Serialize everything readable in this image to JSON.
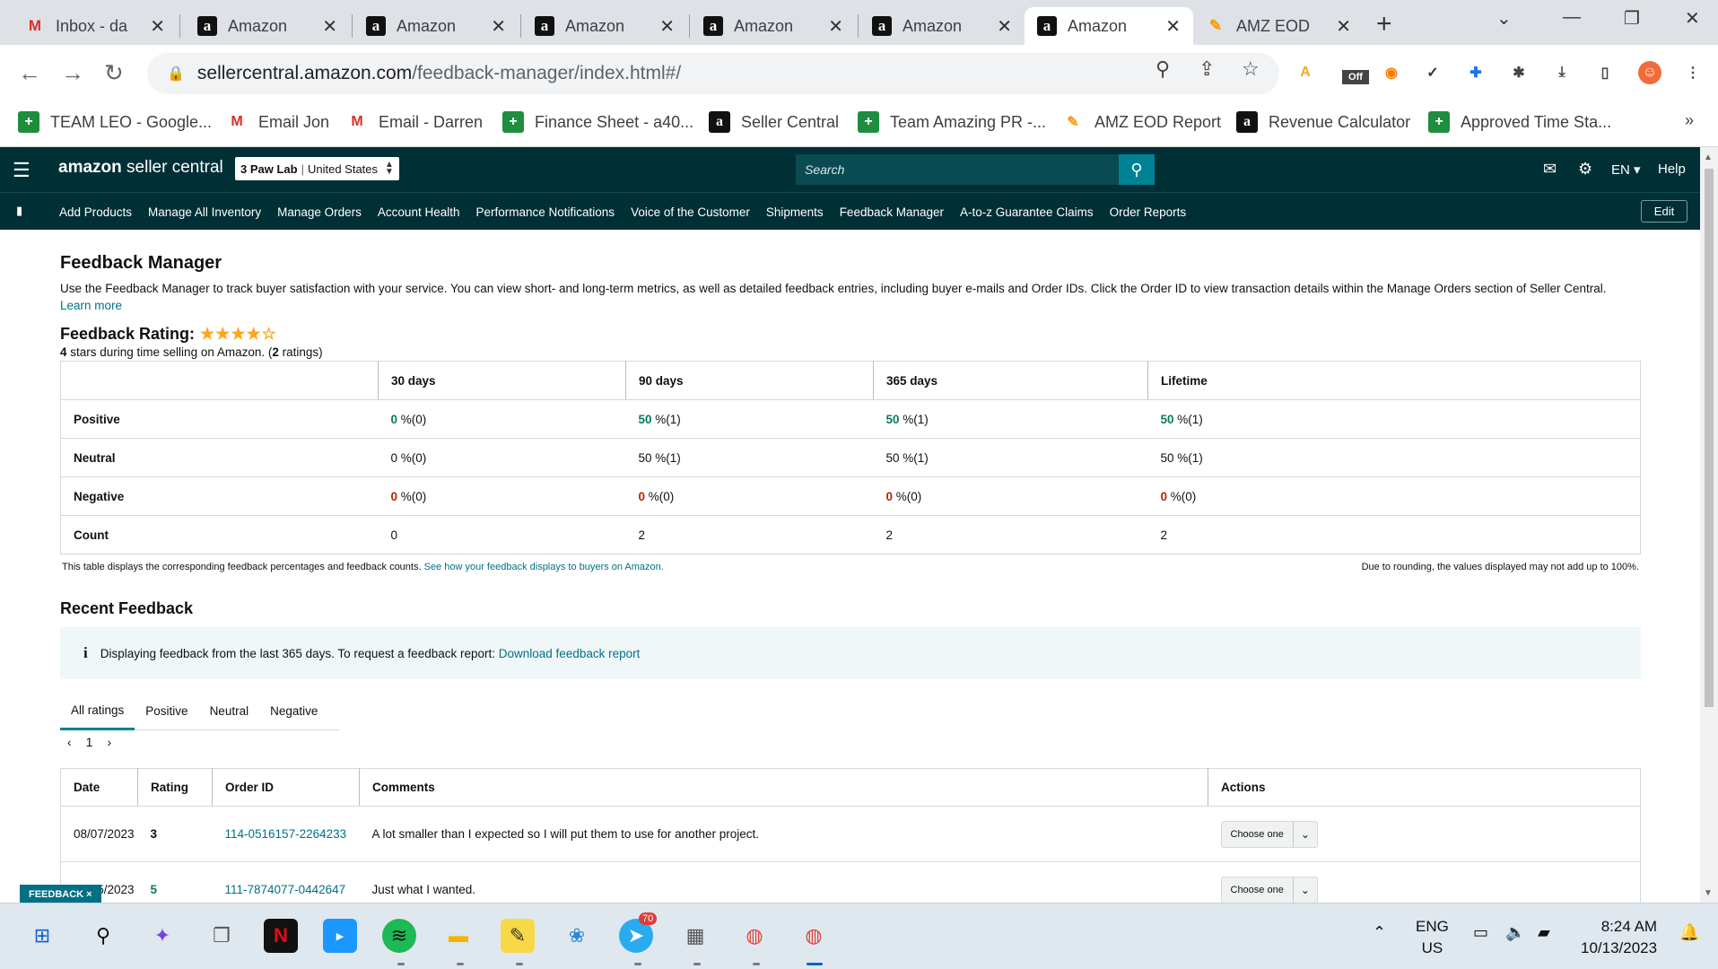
{
  "browser": {
    "tabs": [
      {
        "title": "Inbox - da",
        "icon": "gmail-icon",
        "active": false
      },
      {
        "title": "Amazon",
        "icon": "amazon-icon",
        "active": false
      },
      {
        "title": "Amazon",
        "icon": "amazon-icon",
        "active": false
      },
      {
        "title": "Amazon",
        "icon": "amazon-icon",
        "active": false
      },
      {
        "title": "Amazon",
        "icon": "amazon-icon",
        "active": false
      },
      {
        "title": "Amazon",
        "icon": "amazon-icon",
        "active": false
      },
      {
        "title": "Amazon",
        "icon": "amazon-icon",
        "active": true
      },
      {
        "title": "AMZ EOD",
        "icon": "amz-eod-icon",
        "active": false
      }
    ],
    "url_host": "sellercentral.amazon.com",
    "url_path": "/feedback-manager/index.html#/",
    "extension_badge": "Off",
    "bookmarks": [
      {
        "label": "TEAM LEO - Google...",
        "icon": "sheets"
      },
      {
        "label": "Email Jon",
        "icon": "gmail"
      },
      {
        "label": "Email - Darren",
        "icon": "gmail"
      },
      {
        "label": "Finance Sheet - a40...",
        "icon": "sheets"
      },
      {
        "label": "Seller Central",
        "icon": "amazon"
      },
      {
        "label": "Team Amazing PR -...",
        "icon": "sheets"
      },
      {
        "label": "AMZ EOD Report",
        "icon": "amz"
      },
      {
        "label": "Revenue Calculator",
        "icon": "amazon"
      },
      {
        "label": "Approved Time Sta...",
        "icon": "sheets"
      }
    ],
    "bookmarks_more": "»"
  },
  "header": {
    "logo_main": "amazon",
    "logo_sub": " seller central",
    "store": "3 Paw Lab",
    "marketplace": "United States",
    "search_placeholder": "Search",
    "language": "EN",
    "help": "Help"
  },
  "nav": {
    "links": [
      "Add Products",
      "Manage All Inventory",
      "Manage Orders",
      "Account Health",
      "Performance Notifications",
      "Voice of the Customer",
      "Shipments",
      "Feedback Manager",
      "A-to-z Guarantee Claims",
      "Order Reports"
    ],
    "edit": "Edit"
  },
  "page": {
    "title": "Feedback Manager",
    "description": "Use the Feedback Manager to track buyer satisfaction with your service. You can view short- and long-term metrics, as well as detailed feedback entries, including buyer e-mails and Order IDs. Click the Order ID to view transaction details within the Manage Orders section of Seller Central.",
    "learn_more": "Learn more",
    "rating_title": "Feedback Rating:",
    "rating_stars": 4,
    "rating_max": 5,
    "rating_count_stars": "4",
    "rating_mid": " stars during time selling on Amazon. (",
    "rating_count": "2",
    "rating_end": " ratings)"
  },
  "metrics": {
    "columns": [
      "30 days",
      "90 days",
      "365 days",
      "Lifetime"
    ],
    "rows": [
      {
        "label": "Positive",
        "class": "pos",
        "cells": [
          [
            "0",
            " %(0)"
          ],
          [
            "50",
            " %(1)"
          ],
          [
            "50",
            " %(1)"
          ],
          [
            "50",
            " %(1)"
          ]
        ]
      },
      {
        "label": "Neutral",
        "class": "num",
        "cells": [
          [
            "0",
            " %(0)"
          ],
          [
            "50",
            " %(1)"
          ],
          [
            "50",
            " %(1)"
          ],
          [
            "50",
            " %(1)"
          ]
        ]
      },
      {
        "label": "Negative",
        "class": "neg",
        "cells": [
          [
            "0",
            " %(0)"
          ],
          [
            "0",
            " %(0)"
          ],
          [
            "0",
            " %(0)"
          ],
          [
            "0",
            " %(0)"
          ]
        ]
      },
      {
        "label": "Count",
        "class": "num",
        "cells": [
          [
            "0",
            ""
          ],
          [
            "2",
            ""
          ],
          [
            "2",
            ""
          ],
          [
            "2",
            ""
          ]
        ]
      }
    ],
    "note": "This table displays the corresponding feedback percentages and feedback counts.",
    "note_link": "See how your feedback displays to buyers on Amazon.",
    "rounding_note": "Due to rounding, the values displayed may not add up to 100%."
  },
  "recent": {
    "title": "Recent Feedback",
    "info_text": "Displaying feedback from the last 365 days. To request a feedback report:",
    "info_link": "Download feedback report",
    "tabs": [
      "All ratings",
      "Positive",
      "Neutral",
      "Negative"
    ],
    "page": "1",
    "columns": [
      "Date",
      "Rating",
      "Order ID",
      "Comments",
      "Actions"
    ],
    "rows": [
      {
        "date": "08/07/2023",
        "rating": "3",
        "order_id": "114-0516157-2264233",
        "comment": "A lot smaller than I expected so I will put them to use for another project.",
        "action": "Choose one"
      },
      {
        "date": "07/15/2023",
        "rating": "5",
        "order_id": "111-7874077-0442647",
        "comment": "Just what I wanted.",
        "action": "Choose one"
      }
    ]
  },
  "feedback_tag": "FEEDBACK ×",
  "taskbar": {
    "telegram_badge": "70",
    "lang_top": "ENG",
    "lang_bottom": "US",
    "time": "8:24 AM",
    "date": "10/13/2023"
  }
}
